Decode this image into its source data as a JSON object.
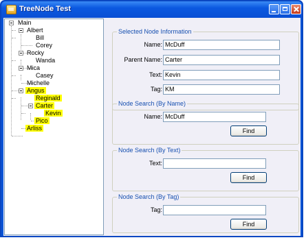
{
  "window": {
    "title": "TreeNode Test"
  },
  "tree": {
    "nodes": [
      {
        "label": "Main"
      },
      {
        "label": "Albert"
      },
      {
        "label": "Bill"
      },
      {
        "label": "Corey"
      },
      {
        "label": "Rocky"
      },
      {
        "label": "Wanda"
      },
      {
        "label": "Mica"
      },
      {
        "label": "Casey"
      },
      {
        "label": "Michelle"
      },
      {
        "label": "Angus"
      },
      {
        "label": "Reginald"
      },
      {
        "label": "Carter"
      },
      {
        "label": "Kevin"
      },
      {
        "label": "Pico"
      },
      {
        "label": "Arliss"
      }
    ],
    "highlight_color": "#ffff00"
  },
  "selected_info": {
    "title": "Selected Node Information",
    "name_label": "Name:",
    "name_value": "McDuff",
    "parent_label": "Parent Name:",
    "parent_value": "Carter",
    "text_label": "Text:",
    "text_value": "Kevin",
    "tag_label": "Tag:",
    "tag_value": "KM"
  },
  "search_name": {
    "title": "Node Search (By Name)",
    "label": "Name:",
    "value": "McDuff",
    "button": "Find"
  },
  "search_text": {
    "title": "Node Search (By Text)",
    "label": "Text:",
    "value": "",
    "button": "Find"
  },
  "search_tag": {
    "title": "Node Search (By Tag)",
    "label": "Tag:",
    "value": "",
    "button": "Find"
  }
}
